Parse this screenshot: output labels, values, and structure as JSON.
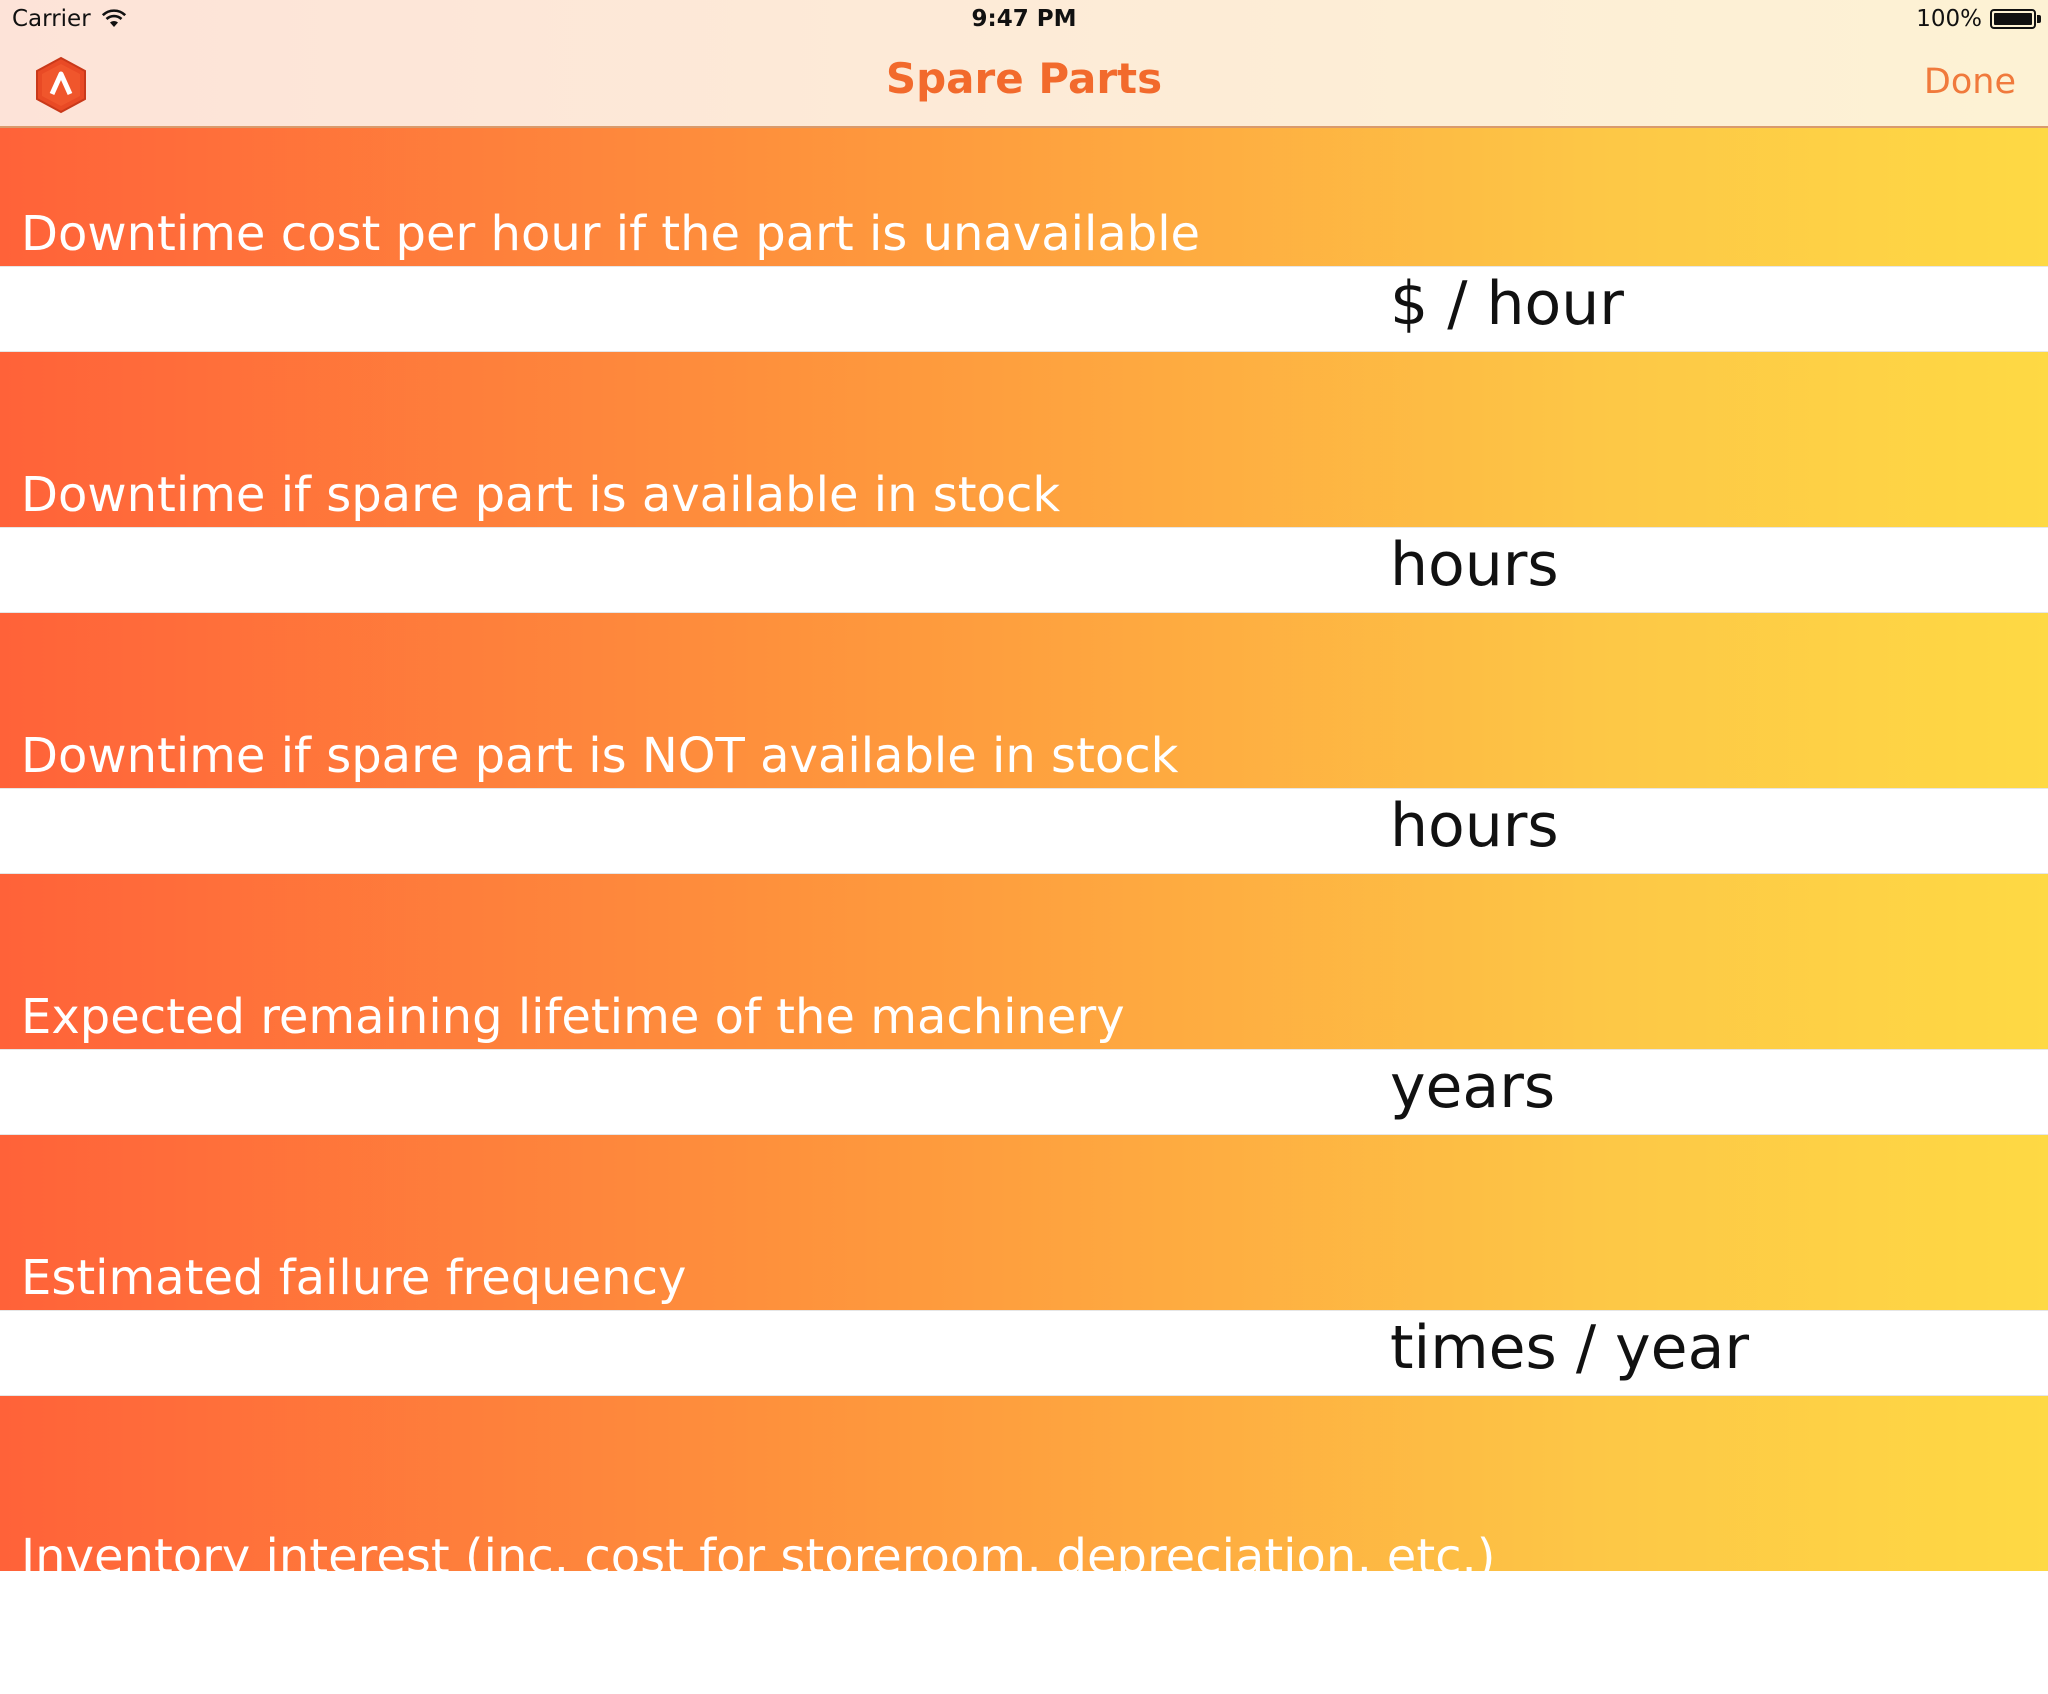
{
  "status_bar": {
    "carrier": "Carrier",
    "time": "9:47 PM",
    "battery": "100%"
  },
  "nav": {
    "title": "Spare Parts",
    "done_label": "Done",
    "logo_icon": "app-logo-icon"
  },
  "colors": {
    "accent": "#f26a2c",
    "gradient_start": "#ff6239",
    "gradient_end": "#fed944"
  },
  "form": {
    "fields": [
      {
        "label": "Downtime cost per hour if the part is unavailable",
        "unit": "$ / hour",
        "value": ""
      },
      {
        "label": "Downtime if spare part is available in stock",
        "unit": "hours",
        "value": ""
      },
      {
        "label": "Downtime if spare part is NOT available in stock",
        "unit": "hours",
        "value": ""
      },
      {
        "label": "Expected remaining lifetime of the machinery",
        "unit": "years",
        "value": ""
      },
      {
        "label": "Estimated failure frequency",
        "unit": "times / year",
        "value": ""
      },
      {
        "label": "Inventory interest (inc. cost for storeroom, depreciation, etc.)"
      }
    ]
  }
}
